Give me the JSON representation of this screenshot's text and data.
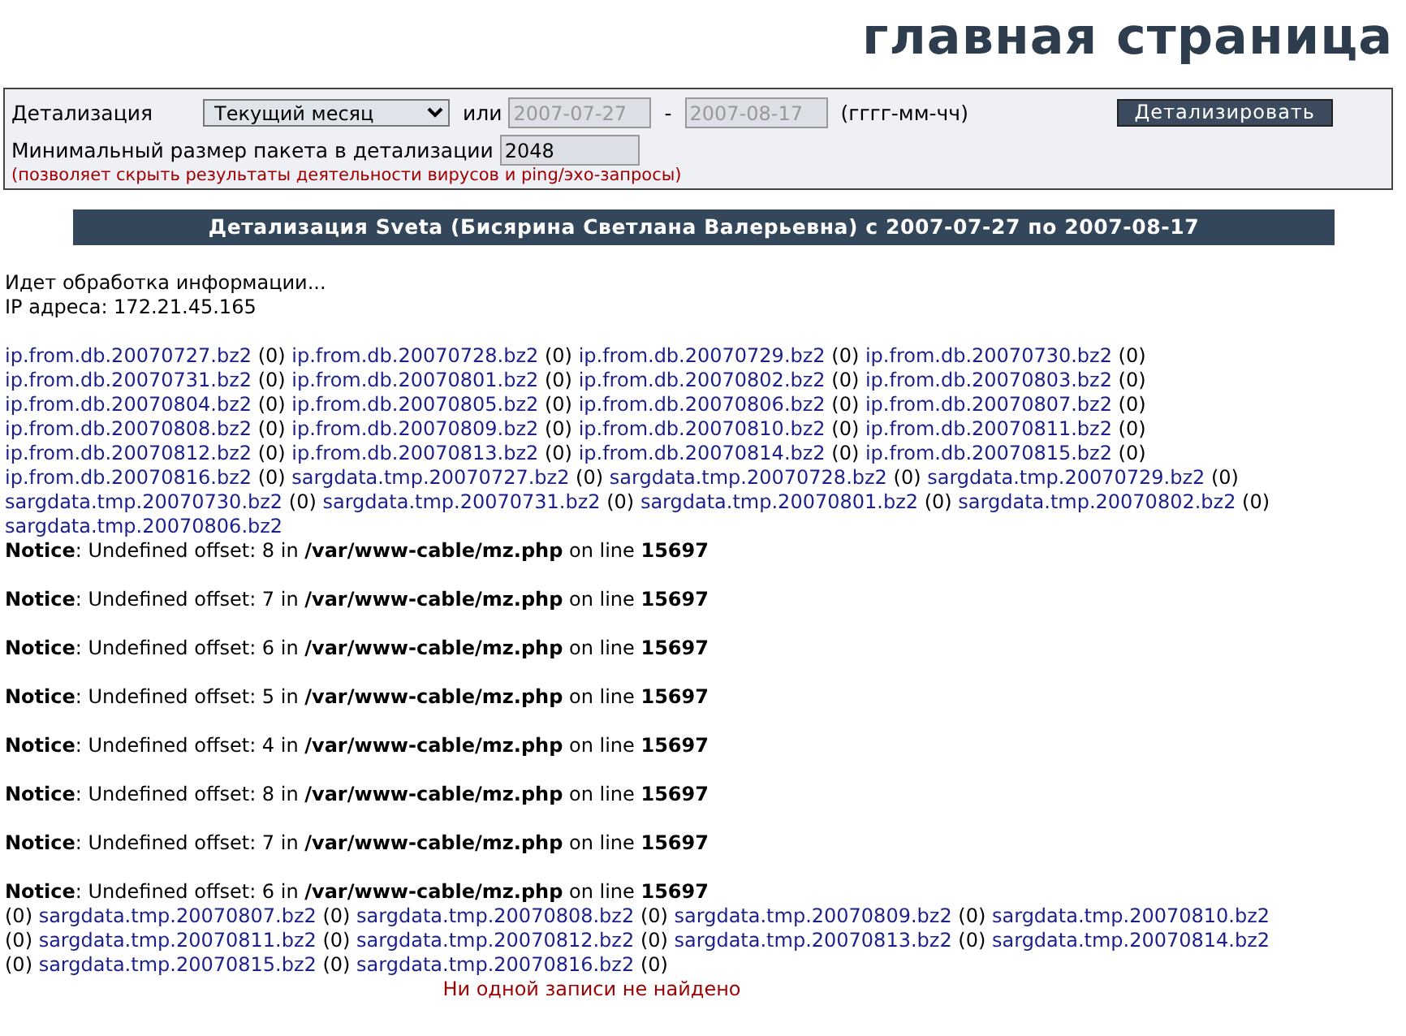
{
  "header": {
    "title": "главная страница"
  },
  "filter_form": {
    "period_label": "Детализация",
    "period_select": {
      "value": "Текущий месяц"
    },
    "or_label": "или",
    "date_from": {
      "value": "2007-07-27",
      "disabled": true
    },
    "dash": "-",
    "date_to": {
      "value": "2007-08-17",
      "disabled": true
    },
    "date_format": "(гггг-мм-чч)",
    "submit_button": "Детализировать",
    "min_size_label": "Минимальный размер пакета в детализации",
    "min_size": {
      "value": "2048",
      "disabled": false
    },
    "min_size_hint": "(позволяет скрыть результаты деятельности вирусов и ping/эхо-запросы)"
  },
  "report_title": "Детализация Sveta (Бисярина Светлана Валерьевна) с 2007-07-27 по 2007-08-17",
  "status_lines": [
    "Идет обработка информации...",
    "IP адреса: 172.21.45.165"
  ],
  "output_blocks": [
    {
      "kind": "files",
      "lines": [
        [
          {
            "kind": "link",
            "text": "ip.from.db.20070727.bz2"
          },
          {
            "kind": "count",
            "text": "(0)"
          },
          {
            "kind": "link",
            "text": "ip.from.db.20070728.bz2"
          },
          {
            "kind": "count",
            "text": "(0)"
          },
          {
            "kind": "link",
            "text": "ip.from.db.20070729.bz2"
          },
          {
            "kind": "count",
            "text": "(0)"
          },
          {
            "kind": "link",
            "text": "ip.from.db.20070730.bz2"
          },
          {
            "kind": "count",
            "text": "(0)"
          }
        ],
        [
          {
            "kind": "link",
            "text": "ip.from.db.20070731.bz2"
          },
          {
            "kind": "count",
            "text": "(0)"
          },
          {
            "kind": "link",
            "text": "ip.from.db.20070801.bz2"
          },
          {
            "kind": "count",
            "text": "(0)"
          },
          {
            "kind": "link",
            "text": "ip.from.db.20070802.bz2"
          },
          {
            "kind": "count",
            "text": "(0)"
          },
          {
            "kind": "link",
            "text": "ip.from.db.20070803.bz2"
          },
          {
            "kind": "count",
            "text": "(0)"
          }
        ],
        [
          {
            "kind": "link",
            "text": "ip.from.db.20070804.bz2"
          },
          {
            "kind": "count",
            "text": "(0)"
          },
          {
            "kind": "link",
            "text": "ip.from.db.20070805.bz2"
          },
          {
            "kind": "count",
            "text": "(0)"
          },
          {
            "kind": "link",
            "text": "ip.from.db.20070806.bz2"
          },
          {
            "kind": "count",
            "text": "(0)"
          },
          {
            "kind": "link",
            "text": "ip.from.db.20070807.bz2"
          },
          {
            "kind": "count",
            "text": "(0)"
          }
        ],
        [
          {
            "kind": "link",
            "text": "ip.from.db.20070808.bz2"
          },
          {
            "kind": "count",
            "text": "(0)"
          },
          {
            "kind": "link",
            "text": "ip.from.db.20070809.bz2"
          },
          {
            "kind": "count",
            "text": "(0)"
          },
          {
            "kind": "link",
            "text": "ip.from.db.20070810.bz2"
          },
          {
            "kind": "count",
            "text": "(0)"
          },
          {
            "kind": "link",
            "text": "ip.from.db.20070811.bz2"
          },
          {
            "kind": "count",
            "text": "(0)"
          }
        ],
        [
          {
            "kind": "link",
            "text": "ip.from.db.20070812.bz2"
          },
          {
            "kind": "count",
            "text": "(0)"
          },
          {
            "kind": "link",
            "text": "ip.from.db.20070813.bz2"
          },
          {
            "kind": "count",
            "text": "(0)"
          },
          {
            "kind": "link",
            "text": "ip.from.db.20070814.bz2"
          },
          {
            "kind": "count",
            "text": "(0)"
          },
          {
            "kind": "link",
            "text": "ip.from.db.20070815.bz2"
          },
          {
            "kind": "count",
            "text": "(0)"
          }
        ],
        [
          {
            "kind": "link",
            "text": "ip.from.db.20070816.bz2"
          },
          {
            "kind": "count",
            "text": "(0)"
          },
          {
            "kind": "link",
            "text": "sargdata.tmp.20070727.bz2"
          },
          {
            "kind": "count",
            "text": "(0)"
          },
          {
            "kind": "link",
            "text": "sargdata.tmp.20070728.bz2"
          },
          {
            "kind": "count",
            "text": "(0)"
          },
          {
            "kind": "link",
            "text": "sargdata.tmp.20070729.bz2"
          },
          {
            "kind": "count",
            "text": "(0)"
          }
        ],
        [
          {
            "kind": "link",
            "text": "sargdata.tmp.20070730.bz2"
          },
          {
            "kind": "count",
            "text": "(0)"
          },
          {
            "kind": "link",
            "text": "sargdata.tmp.20070731.bz2"
          },
          {
            "kind": "count",
            "text": "(0)"
          },
          {
            "kind": "link",
            "text": "sargdata.tmp.20070801.bz2"
          },
          {
            "kind": "count",
            "text": "(0)"
          },
          {
            "kind": "link",
            "text": "sargdata.tmp.20070802.bz2"
          },
          {
            "kind": "count",
            "text": "(0)"
          }
        ],
        [
          {
            "kind": "link",
            "text": "sargdata.tmp.20070806.bz2"
          }
        ]
      ]
    },
    {
      "kind": "notice",
      "text": "**Notice**: Undefined offset: 8 in **/var/www-cable/mz.php** on line **15697**"
    },
    {
      "kind": "notice",
      "text": "**Notice**: Undefined offset: 7 in **/var/www-cable/mz.php** on line **15697**"
    },
    {
      "kind": "notice",
      "text": "**Notice**: Undefined offset: 6 in **/var/www-cable/mz.php** on line **15697**"
    },
    {
      "kind": "notice",
      "text": "**Notice**: Undefined offset: 5 in **/var/www-cable/mz.php** on line **15697**"
    },
    {
      "kind": "notice",
      "text": "**Notice**: Undefined offset: 4 in **/var/www-cable/mz.php** on line **15697**"
    },
    {
      "kind": "notice",
      "text": "**Notice**: Undefined offset: 8 in **/var/www-cable/mz.php** on line **15697**"
    },
    {
      "kind": "notice",
      "text": "**Notice**: Undefined offset: 7 in **/var/www-cable/mz.php** on line **15697**"
    },
    {
      "kind": "notice",
      "text": "**Notice**: Undefined offset: 6 in **/var/www-cable/mz.php** on line **15697**"
    },
    {
      "kind": "files",
      "lines": [
        [
          {
            "kind": "count",
            "text": "(0)"
          },
          {
            "kind": "link",
            "text": "sargdata.tmp.20070807.bz2"
          },
          {
            "kind": "count",
            "text": "(0)"
          },
          {
            "kind": "link",
            "text": "sargdata.tmp.20070808.bz2"
          },
          {
            "kind": "count",
            "text": "(0)"
          },
          {
            "kind": "link",
            "text": "sargdata.tmp.20070809.bz2"
          },
          {
            "kind": "count",
            "text": "(0)"
          },
          {
            "kind": "link",
            "text": "sargdata.tmp.20070810.bz2"
          }
        ],
        [
          {
            "kind": "count",
            "text": "(0)"
          },
          {
            "kind": "link",
            "text": "sargdata.tmp.20070811.bz2"
          },
          {
            "kind": "count",
            "text": "(0)"
          },
          {
            "kind": "link",
            "text": "sargdata.tmp.20070812.bz2"
          },
          {
            "kind": "count",
            "text": "(0)"
          },
          {
            "kind": "link",
            "text": "sargdata.tmp.20070813.bz2"
          },
          {
            "kind": "count",
            "text": "(0)"
          },
          {
            "kind": "link",
            "text": "sargdata.tmp.20070814.bz2"
          }
        ],
        [
          {
            "kind": "count",
            "text": "(0)"
          },
          {
            "kind": "link",
            "text": "sargdata.tmp.20070815.bz2"
          },
          {
            "kind": "count",
            "text": "(0)"
          },
          {
            "kind": "link",
            "text": "sargdata.tmp.20070816.bz2"
          },
          {
            "kind": "count",
            "text": "(0)"
          }
        ]
      ]
    }
  ],
  "result_message": "Ни одной записи не найдено"
}
